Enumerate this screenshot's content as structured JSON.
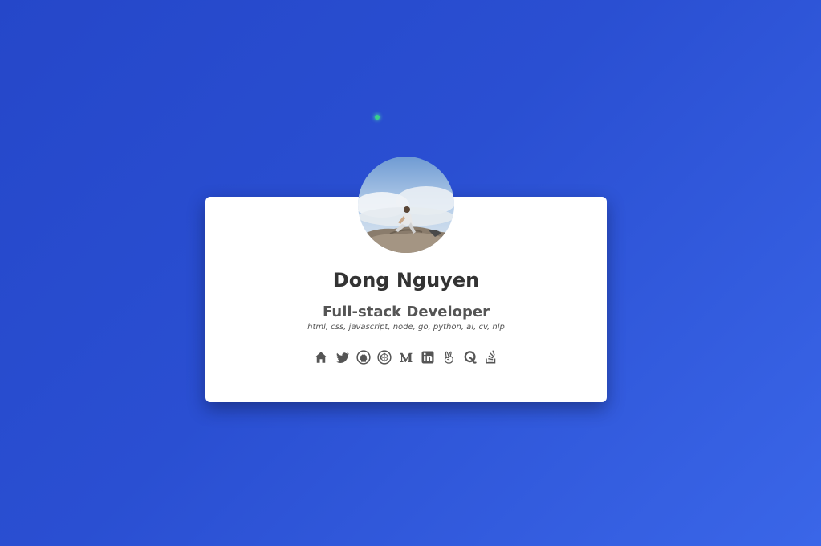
{
  "profile": {
    "name": "Dong Nguyen",
    "role": "Full-stack Developer",
    "skills": "html, css, javascript, node, go, python, ai, cv, nlp"
  },
  "socials": [
    {
      "icon": "home-icon"
    },
    {
      "icon": "twitter-icon"
    },
    {
      "icon": "github-icon"
    },
    {
      "icon": "codepen-icon"
    },
    {
      "icon": "medium-icon"
    },
    {
      "icon": "linkedin-icon"
    },
    {
      "icon": "angellist-icon"
    },
    {
      "icon": "quora-icon"
    },
    {
      "icon": "stackoverflow-icon"
    }
  ],
  "colors": {
    "background_start": "#2547c9",
    "background_end": "#3a66e8",
    "card": "#ffffff",
    "name_text": "#333333",
    "secondary_text": "#555555",
    "icon": "#555555",
    "status_dot": "#37d08a"
  }
}
